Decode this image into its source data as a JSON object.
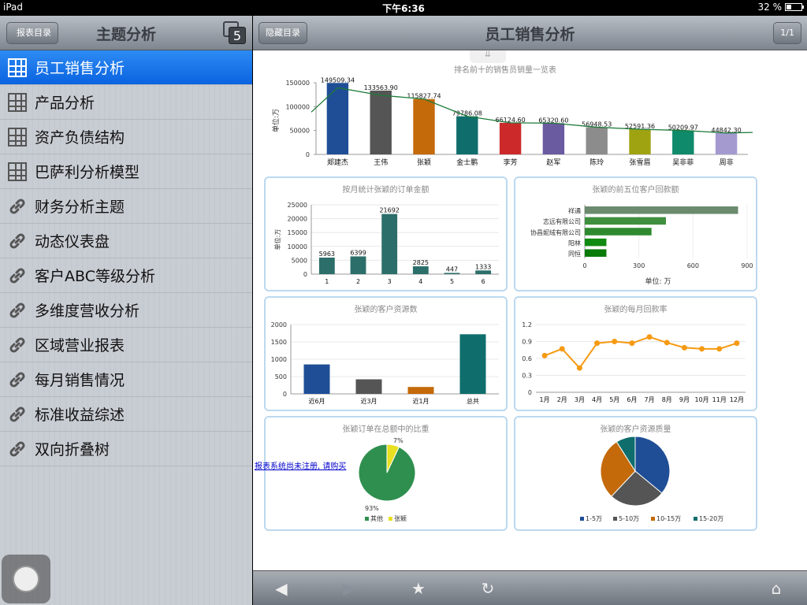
{
  "status_bar": {
    "device": "iPad",
    "time": "下午6:36",
    "battery": "32 %"
  },
  "left_panel": {
    "back_button": "报表目录",
    "title": "主题分析",
    "tab_count": "5",
    "items": [
      {
        "label": "员工销售分析",
        "icon": "grid-icon",
        "selected": true
      },
      {
        "label": "产品分析",
        "icon": "grid-icon"
      },
      {
        "label": "资产负债结构",
        "icon": "grid-icon"
      },
      {
        "label": "巴萨利分析模型",
        "icon": "grid-icon"
      },
      {
        "label": "财务分析主题",
        "icon": "link-icon"
      },
      {
        "label": "动态仪表盘",
        "icon": "link-icon"
      },
      {
        "label": "客户ABC等级分析",
        "icon": "link-icon"
      },
      {
        "label": "多维度营收分析",
        "icon": "link-icon"
      },
      {
        "label": "区域营业报表",
        "icon": "link-icon"
      },
      {
        "label": "每月销售情况",
        "icon": "link-icon"
      },
      {
        "label": "标准收益综述",
        "icon": "link-icon"
      },
      {
        "label": "双向折叠树",
        "icon": "link-icon"
      }
    ]
  },
  "right_panel": {
    "hide_button": "隐藏目录",
    "title": "员工销售分析",
    "page": "1/1",
    "watermark": "报表系统尚未注册, 请购买"
  },
  "chart_data": [
    {
      "type": "bar",
      "title": "排名前十的销售员销量一览表",
      "ylabel": "单位:万",
      "ylim": [
        0,
        150000
      ],
      "yticks": [
        0,
        50000,
        100000,
        150000
      ],
      "categories": [
        "郑建杰",
        "王伟",
        "张颖",
        "金士鹏",
        "李芳",
        "赵军",
        "陈玲",
        "张雪眉",
        "吴非菲",
        "周非"
      ],
      "values": [
        149509.34,
        133563.9,
        115827.74,
        79786.08,
        66124.6,
        65320.6,
        56948.53,
        52591.36,
        50209.97,
        44842.3
      ],
      "labels": [
        "149509.34",
        "133563.90",
        "115827.74",
        "79786.08",
        "66124.60",
        "65320.60",
        "56948.53",
        "52591.36",
        "50209.97",
        "44842.30"
      ],
      "colors": [
        "#1f4e96",
        "#555555",
        "#c46a0a",
        "#0f6e6c",
        "#cc2a2a",
        "#6a5aa0",
        "#8c8c8c",
        "#9fa312",
        "#0f8a6a",
        "#a49ad0"
      ],
      "trendline": true
    },
    {
      "type": "bar",
      "title": "按月统计张颖的订单金额",
      "ylabel": "单位:万",
      "ylim": [
        0,
        25000
      ],
      "yticks": [
        0,
        5000,
        10000,
        15000,
        20000,
        25000
      ],
      "categories": [
        "1",
        "2",
        "3",
        "4",
        "5",
        "6"
      ],
      "values": [
        5963,
        6399,
        21692,
        2825,
        447,
        1333
      ],
      "color": "#2c6e6a"
    },
    {
      "type": "bar",
      "orientation": "horizontal",
      "title": "张颖的前五位客户回款额",
      "xlabel": "单位: 万",
      "xlim": [
        0,
        900
      ],
      "xticks": [
        0,
        300,
        600,
        900
      ],
      "categories": [
        "祥通",
        "志远有限公司",
        "协昌妮绒有限公司",
        "阳林",
        "同恒"
      ],
      "values": [
        850,
        450,
        370,
        120,
        120
      ],
      "colors": [
        "#6b8a6e",
        "#3f8f3f",
        "#2f8a2f",
        "#118a11",
        "#0a7a0a"
      ]
    },
    {
      "type": "bar",
      "title": "张颖的客户资源数",
      "ylim": [
        0,
        2000
      ],
      "yticks": [
        0,
        500,
        1000,
        1500,
        2000
      ],
      "categories": [
        "近6月",
        "近3月",
        "近1月",
        "总共"
      ],
      "values": [
        850,
        420,
        200,
        1720
      ],
      "colors": [
        "#1f4e96",
        "#555555",
        "#c46a0a",
        "#0f6e6c"
      ]
    },
    {
      "type": "line",
      "title": "张颖的每月回款率",
      "ylim": [
        0,
        1.2
      ],
      "yticks": [
        0,
        0.3,
        0.6,
        0.9,
        1.2
      ],
      "categories": [
        "1月",
        "2月",
        "3月",
        "4月",
        "5月",
        "6月",
        "7月",
        "8月",
        "9月",
        "10月",
        "11月",
        "12月"
      ],
      "values": [
        0.65,
        0.77,
        0.43,
        0.87,
        0.9,
        0.87,
        0.98,
        0.88,
        0.79,
        0.77,
        0.77,
        0.87
      ],
      "color": "#f59a12"
    },
    {
      "type": "pie",
      "title": "张颖订单在总额中的比重",
      "slices": [
        {
          "name": "其他",
          "value": 93,
          "label": "93%",
          "color": "#2f8f4f"
        },
        {
          "name": "张颖",
          "value": 7,
          "label": "7%",
          "color": "#e8e020"
        }
      ]
    },
    {
      "type": "pie",
      "title": "张颖的客户资源质量",
      "slices": [
        {
          "name": "1-5万",
          "value": 36,
          "color": "#1f4e96"
        },
        {
          "name": "5-10万",
          "value": 26,
          "color": "#555555"
        },
        {
          "name": "10-15万",
          "value": 29,
          "color": "#c46a0a"
        },
        {
          "name": "15-20万",
          "value": 9,
          "color": "#0f6e6c"
        }
      ]
    }
  ]
}
